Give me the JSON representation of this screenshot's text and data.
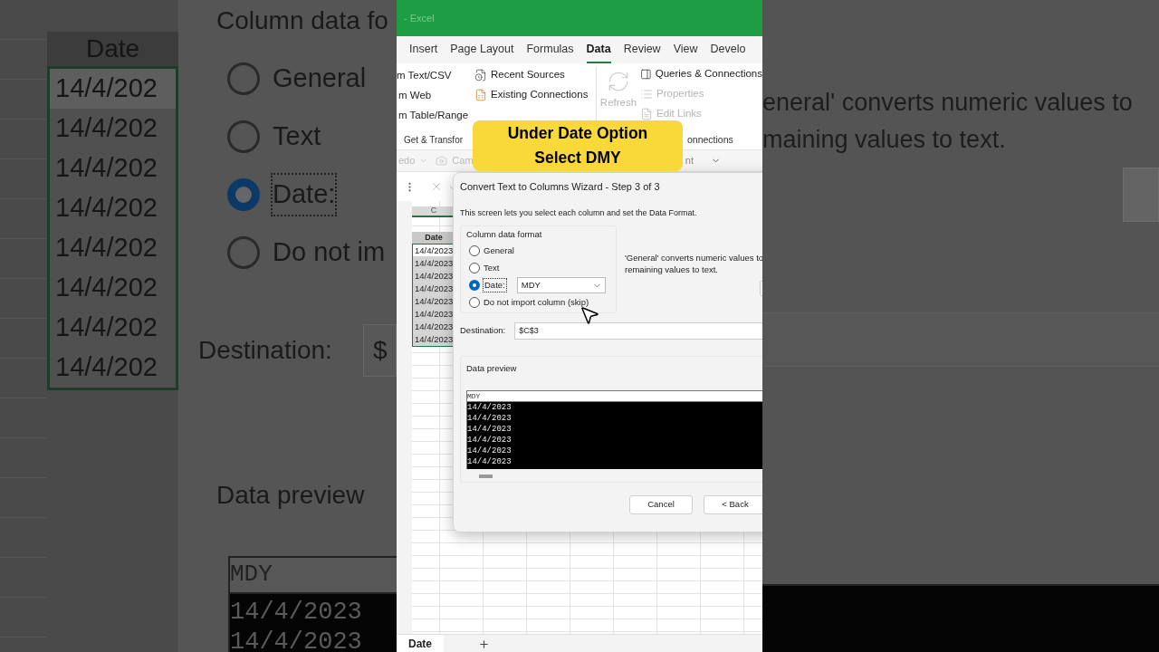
{
  "app": {
    "title": "- Excel"
  },
  "ribbon_tabs": [
    {
      "label": "Insert",
      "selected": false
    },
    {
      "label": "Page Layout",
      "selected": false
    },
    {
      "label": "Formulas",
      "selected": false
    },
    {
      "label": "Data",
      "selected": true
    },
    {
      "label": "Review",
      "selected": false
    },
    {
      "label": "View",
      "selected": false
    },
    {
      "label": "Develo",
      "selected": false
    }
  ],
  "ribbon": {
    "import_items": [
      "m Text/CSV",
      "m Web",
      "m Table/Range"
    ],
    "sources": [
      "Recent Sources",
      "Existing Connections"
    ],
    "group_label": "Get & Transfor",
    "refresh": {
      "label": "Refresh",
      "disabled": true
    },
    "queries": [
      {
        "label": "Queries & Connections",
        "disabled": false
      },
      {
        "label": "Properties",
        "disabled": true
      },
      {
        "label": "Edit Links",
        "disabled": true
      }
    ],
    "group_label_2": "onnections"
  },
  "quick_access": {
    "undo": "edo",
    "camera": "Cam",
    "right": "nt"
  },
  "caption": [
    "Under Date Option",
    "Select DMY"
  ],
  "sheet": {
    "column": "C",
    "header": "Date",
    "cells": [
      "14/4/2023",
      "14/4/2023",
      "14/4/2023",
      "14/4/2023",
      "14/4/2023",
      "14/4/2023",
      "14/4/2023",
      "14/4/2023"
    ]
  },
  "dialog": {
    "title": "Convert Text to Columns Wizard - Step 3 of 3",
    "description": "This screen lets you select each column and set the Data Format.",
    "format_label": "Column data format",
    "options": [
      {
        "label": "General",
        "selected": false
      },
      {
        "label": "Text",
        "selected": false
      },
      {
        "label": "Date:",
        "selected": true
      },
      {
        "label": "Do not import column (skip)",
        "selected": false
      }
    ],
    "date_order": "MDY",
    "note": [
      "'General' converts numeric values to",
      "remaining values to text."
    ],
    "destination": {
      "label": "Destination:",
      "value": "$C$3"
    },
    "preview": {
      "label": "Data preview",
      "header": "MDY",
      "rows": [
        "14/4/2023",
        "14/4/2023",
        "14/4/2023",
        "14/4/2023",
        "14/4/2023",
        "14/4/2023"
      ]
    },
    "buttons": [
      "Cancel",
      "< Back"
    ]
  },
  "sheet_tabs": [
    {
      "label": "Date",
      "selected": true
    }
  ],
  "backdrop": {
    "left": {
      "header": "Date",
      "cells": [
        "14/4/202",
        "14/4/202",
        "14/4/202",
        "14/4/202",
        "14/4/202",
        "14/4/202",
        "14/4/202",
        "14/4/202"
      ],
      "group_label": "Column data fo",
      "options": [
        {
          "label": "General",
          "selected": false
        },
        {
          "label": "Text",
          "selected": false
        },
        {
          "label": "Date:",
          "selected": true
        },
        {
          "label": "Do not im",
          "selected": false
        }
      ],
      "destination_label": "Destination:",
      "destination_value": "$",
      "preview_label": "Data preview",
      "preview_header": "MDY",
      "preview_rows": [
        "14/4/2023",
        "14/4/2023"
      ]
    },
    "right": {
      "note": [
        "eneral' converts numeric values to",
        "maining values to text."
      ]
    }
  }
}
